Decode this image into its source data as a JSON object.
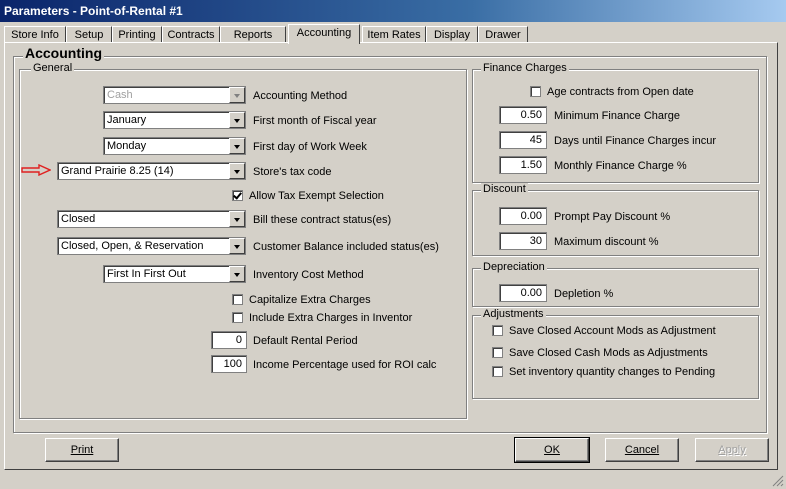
{
  "window": {
    "title": "Parameters - Point-of-Rental #1"
  },
  "tabs": [
    {
      "label": "Store Info"
    },
    {
      "label": "Setup"
    },
    {
      "label": "Printing"
    },
    {
      "label": "Contracts"
    },
    {
      "label": "Reports"
    },
    {
      "label": "Accounting",
      "active": true
    },
    {
      "label": "Item Rates"
    },
    {
      "label": "Display"
    },
    {
      "label": "Drawer"
    }
  ],
  "page": {
    "heading": "Accounting"
  },
  "general": {
    "legend": "General",
    "accounting_method": {
      "value": "Cash",
      "label": "Accounting Method"
    },
    "fiscal_month": {
      "value": "January",
      "label": "First month of Fiscal year"
    },
    "work_week": {
      "value": "Monday",
      "label": "First day of Work Week"
    },
    "tax_code": {
      "value": "Grand Prairie 8.25 (14)",
      "label": "Store's tax code"
    },
    "allow_tax_exempt": {
      "label": "Allow Tax Exempt Selection",
      "checked": true
    },
    "bill_status": {
      "value": "Closed",
      "label": "Bill these contract status(es)"
    },
    "customer_balance": {
      "value": "Closed, Open, & Reservation",
      "label": "Customer Balance included status(es)"
    },
    "inventory_cost": {
      "value": "First In First Out",
      "label": "Inventory Cost Method"
    },
    "capitalize_extra": {
      "label": "Capitalize Extra Charges",
      "checked": false
    },
    "include_extra": {
      "label": "Include  Extra  Charges  in Inventor",
      "checked": false
    },
    "default_rental": {
      "value": "0",
      "label": "Default Rental Period"
    },
    "income_pct": {
      "value": "100",
      "label": "Income Percentage used for ROI calc"
    }
  },
  "finance": {
    "legend": "Finance Charges",
    "age_contracts": {
      "label": "Age contracts from Open date",
      "checked": false
    },
    "min_charge": {
      "value": "0.50",
      "label": "Minimum Finance Charge"
    },
    "days_until": {
      "value": "45",
      "label": "Days until Finance Charges incur"
    },
    "monthly_pct": {
      "value": "1.50",
      "label": "Monthly Finance Charge %"
    }
  },
  "discount": {
    "legend": "Discount",
    "prompt_pay": {
      "value": "0.00",
      "label": "Prompt Pay Discount %"
    },
    "max_discount": {
      "value": "30",
      "label": "Maximum discount %"
    }
  },
  "depreciation": {
    "legend": "Depreciation",
    "depletion": {
      "value": "0.00",
      "label": "Depletion %"
    }
  },
  "adjustments": {
    "legend": "Adjustments",
    "closed_account": {
      "label": "Save Closed Account Mods  as Adjustment",
      "checked": false
    },
    "closed_cash": {
      "label": "Save Closed Cash Mods as Adjustments",
      "checked": false
    },
    "inventory_pending": {
      "label": "Set inventory quantity changes to Pending",
      "checked": false
    }
  },
  "buttons": {
    "print": "Print",
    "ok": "OK",
    "cancel": "Cancel",
    "apply": "Apply"
  },
  "colors": {
    "title_bar": "#0a246a",
    "face": "#d4d0c8",
    "arrow": "#e02020"
  }
}
